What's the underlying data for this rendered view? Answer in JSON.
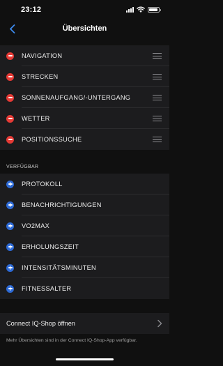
{
  "status_bar": {
    "time": "23:12",
    "battery_level": 0.9
  },
  "nav": {
    "title": "Übersichten",
    "back_icon": "chevron-left-icon",
    "accent_color": "#3d8bf0"
  },
  "active_items": [
    {
      "label": "NAVIGATION"
    },
    {
      "label": "STRECKEN"
    },
    {
      "label": "SONNENAUFGANG/-UNTERGANG"
    },
    {
      "label": "WETTER"
    },
    {
      "label": "POSITIONSSUCHE"
    }
  ],
  "available": {
    "header": "VERFÜGBAR",
    "items": [
      {
        "label": "PROTOKOLL"
      },
      {
        "label": "BENACHRICHTIGUNGEN"
      },
      {
        "label": "VO2MAX"
      },
      {
        "label": "ERHOLUNGSZEIT"
      },
      {
        "label": "INTENSITÄTSMINUTEN"
      },
      {
        "label": "FITNESSALTER"
      }
    ]
  },
  "store": {
    "label": "Connect IQ-Shop öffnen",
    "note": "Mehr Übersichten sind in der Connect IQ-Shop-App verfügbar."
  },
  "colors": {
    "remove": "#e53a35",
    "add": "#2d6ad6",
    "background": "#101010",
    "group_background": "#1c1c1e"
  }
}
